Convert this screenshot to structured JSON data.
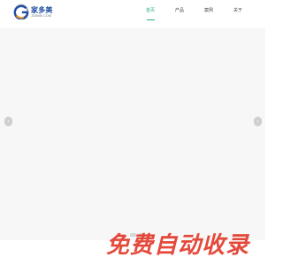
{
  "header": {
    "logo": {
      "name": "家多美",
      "domain": "JDDME.COM",
      "icon": "g-swirl-logo-icon",
      "colors": {
        "blue": "#1f4fa3",
        "orange": "#f39a1e",
        "gray": "#9aa3ad"
      }
    },
    "nav": [
      {
        "label": "首页",
        "active": true
      },
      {
        "label": "产品",
        "active": false
      },
      {
        "label": "案例",
        "active": false
      },
      {
        "label": "关于",
        "active": false
      }
    ],
    "accent_color": "#2fae7a"
  },
  "banner": {
    "prev_icon": "chevron-left-icon",
    "next_icon": "chevron-right-icon",
    "prev_symbol": "‹",
    "next_symbol": "›",
    "slide_count": 2
  },
  "watermark": {
    "text": "免费自动收录",
    "color": "#e23b2b"
  }
}
